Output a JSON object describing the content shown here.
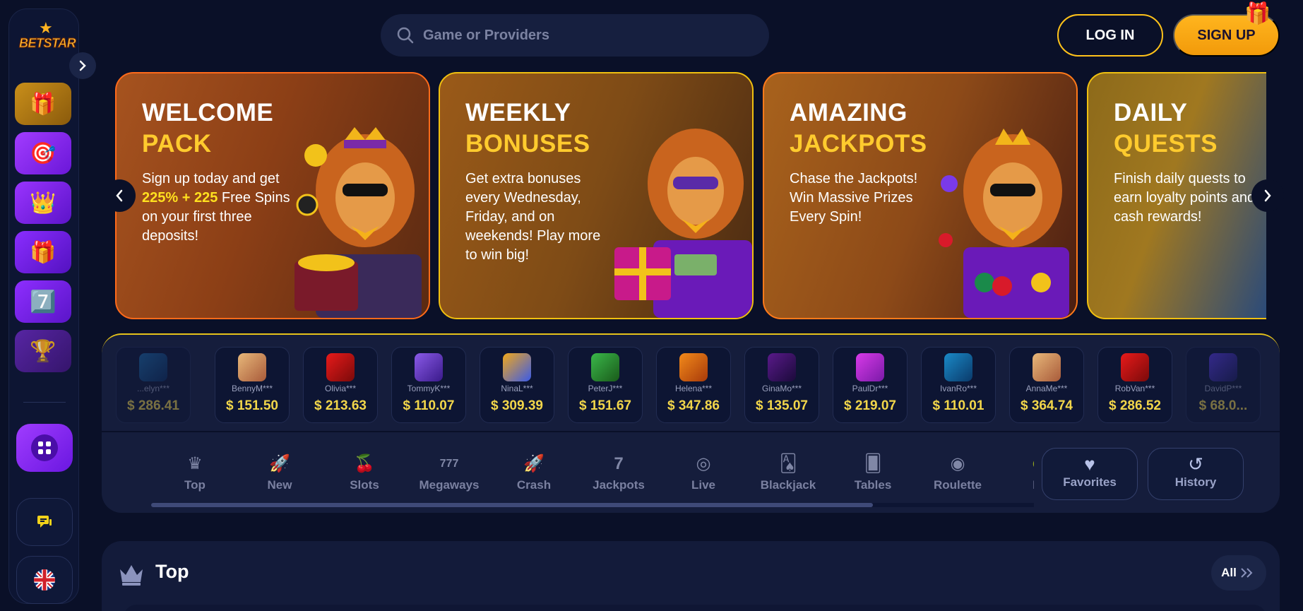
{
  "brand": {
    "logo_text": "BETSTAR"
  },
  "header": {
    "search_placeholder": "Game or Providers",
    "login_label": "LOG IN",
    "signup_label": "SIGN UP"
  },
  "sidebar": {
    "tiles": [
      {
        "name": "gift-box",
        "icon": "🎁"
      },
      {
        "name": "target",
        "icon": "🎯"
      },
      {
        "name": "crown",
        "icon": "👑"
      },
      {
        "name": "present",
        "icon": "🎁"
      },
      {
        "name": "sevens",
        "icon": "7️⃣"
      },
      {
        "name": "trophy",
        "icon": "🏆"
      }
    ]
  },
  "banners": [
    {
      "title_white": "WELCOME",
      "title_yellow": "PACK",
      "text_a": "Sign up today and get ",
      "highlight": "225% + 225",
      "text_b": " Free Spins on your first three deposits!"
    },
    {
      "title_white": "WEEKLY",
      "title_yellow": "BONUSES",
      "text": "Get extra bonuses every Wednesday, Friday, and on weekends! Play more to win big!"
    },
    {
      "title_white": "AMAZING",
      "title_yellow": "JACKPOTS",
      "text": "Chase the Jackpots! Win Massive Prizes Every Spin!"
    },
    {
      "title_white": "DAILY",
      "title_yellow": "QUESTS",
      "text": "Finish daily quests to earn loyalty points and cash rewards!"
    }
  ],
  "winners": [
    {
      "name": "...elyn***",
      "amount": "$ 286.41"
    },
    {
      "name": "BennyM***",
      "amount": "$ 151.50"
    },
    {
      "name": "Olivia***",
      "amount": "$ 213.63"
    },
    {
      "name": "TommyK***",
      "amount": "$ 110.07"
    },
    {
      "name": "NinaL***",
      "amount": "$ 309.39"
    },
    {
      "name": "PeterJ***",
      "amount": "$ 151.67"
    },
    {
      "name": "Helena***",
      "amount": "$ 347.86"
    },
    {
      "name": "GinaMo***",
      "amount": "$ 135.07"
    },
    {
      "name": "PaulDr***",
      "amount": "$ 219.07"
    },
    {
      "name": "IvanRo***",
      "amount": "$ 110.01"
    },
    {
      "name": "AnnaMe***",
      "amount": "$ 364.74"
    },
    {
      "name": "RobVan***",
      "amount": "$ 286.52"
    },
    {
      "name": "DavidP***",
      "amount": "$ 68.0..."
    }
  ],
  "categories": [
    {
      "label": "Top",
      "icon": "♛"
    },
    {
      "label": "New",
      "icon": "🚀"
    },
    {
      "label": "Slots",
      "icon": "🍒"
    },
    {
      "label": "Megaways",
      "icon": "777"
    },
    {
      "label": "Crash",
      "icon": "🚀"
    },
    {
      "label": "Jackpots",
      "icon": "7"
    },
    {
      "label": "Live",
      "icon": "◎"
    },
    {
      "label": "Blackjack",
      "icon": "🂡"
    },
    {
      "label": "Tables",
      "icon": "🂠"
    },
    {
      "label": "Roulette",
      "icon": "◉"
    },
    {
      "label": "Fru",
      "icon": "🍋"
    }
  ],
  "quick_buttons": {
    "favorites_label": "Favorites",
    "history_label": "History"
  },
  "top_section": {
    "title": "Top",
    "all_label": "All"
  },
  "colors": {
    "accent_yellow": "#ffc21a",
    "purple": "#8a2dff",
    "bg": "#0a1028"
  }
}
